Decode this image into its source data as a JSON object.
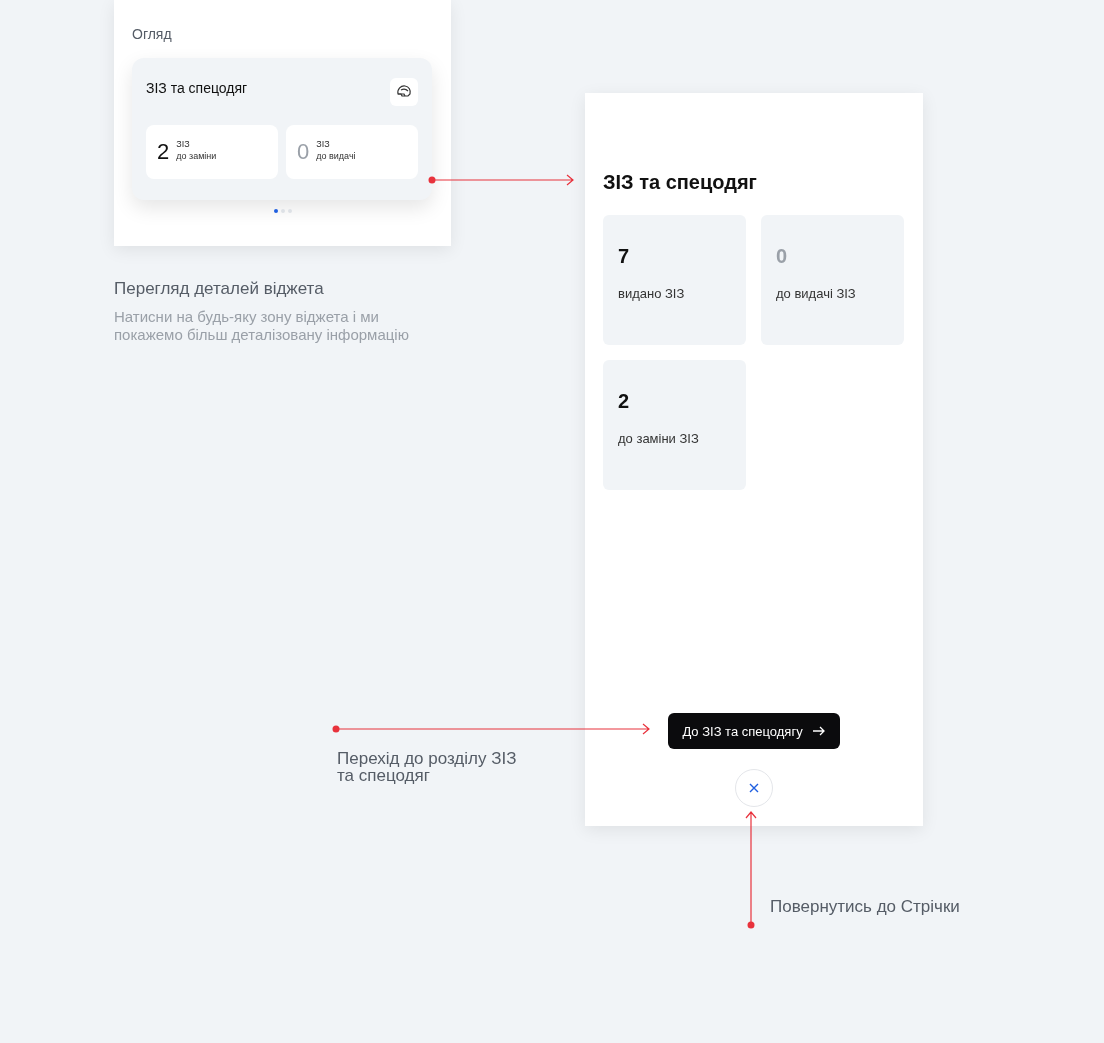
{
  "overview_screen": {
    "section_title": "Огляд",
    "widget": {
      "title": "ЗІЗ та спецодяг",
      "stats": [
        {
          "value": "2",
          "label_top": "ЗІЗ",
          "label_bottom": "до заміни",
          "muted": false
        },
        {
          "value": "0",
          "label_top": "ЗІЗ",
          "label_bottom": "до видачі",
          "muted": true
        }
      ]
    },
    "page_dots": [
      {
        "selected": true
      },
      {
        "selected": false
      },
      {
        "selected": false
      }
    ]
  },
  "overview_caption": {
    "title": "Перегляд деталей віджета",
    "text": "Натисни на будь-яку зону віджета і ми покажемо більш деталізовану інформацію"
  },
  "details_screen": {
    "title": "ЗІЗ та спецодяг",
    "tiles": [
      {
        "value": "7",
        "label": "видано ЗІЗ",
        "muted": false
      },
      {
        "value": "0",
        "label": "до видачі ЗІЗ",
        "muted": true
      },
      {
        "value": "2",
        "label": "до заміни ЗІЗ",
        "muted": false
      }
    ],
    "button": "До ЗІЗ та спецодягу"
  },
  "annotations": [
    {
      "text": "Перехід до розділу ЗІЗ\nта спецодяг"
    },
    {
      "text": "Повернутись до Стрічки"
    }
  ]
}
